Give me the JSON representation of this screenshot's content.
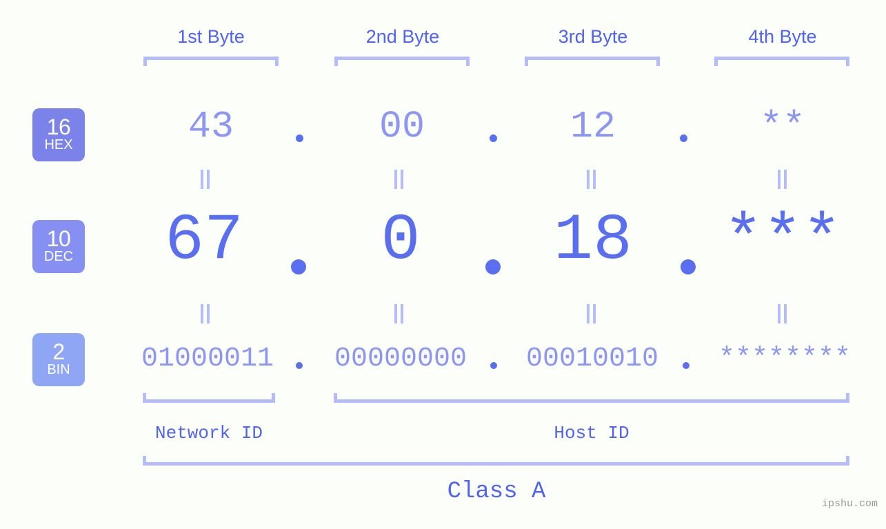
{
  "meta": {
    "background": "#fcfefa",
    "accent_dark": "#5163ef",
    "accent_mid": "#5a6ef0",
    "accent_light": "#8d97f2",
    "accent_pale": "#b4bcfb",
    "watermark": "ipshu.com"
  },
  "byte_headers": [
    {
      "label": "1st Byte"
    },
    {
      "label": "2nd Byte"
    },
    {
      "label": "3rd Byte"
    },
    {
      "label": "4th Byte"
    }
  ],
  "rows": [
    {
      "badge_number": "16",
      "badge_tag": "HEX",
      "badge_color": "#7b82ea",
      "values": [
        "43",
        "00",
        "12",
        "**"
      ],
      "separator": "."
    },
    {
      "badge_number": "10",
      "badge_tag": "DEC",
      "badge_color": "#8690f2",
      "values": [
        "67",
        "0",
        "18",
        "***"
      ],
      "separator": "."
    },
    {
      "badge_number": "2",
      "badge_tag": "BIN",
      "badge_color": "#8fa6f5",
      "values": [
        "01000011",
        "00000000",
        "00010010",
        "********"
      ],
      "separator": "."
    }
  ],
  "equality_symbol": "=",
  "id_sections": [
    {
      "label": "Network ID"
    },
    {
      "label": "Host ID"
    }
  ],
  "class_label": "Class A"
}
